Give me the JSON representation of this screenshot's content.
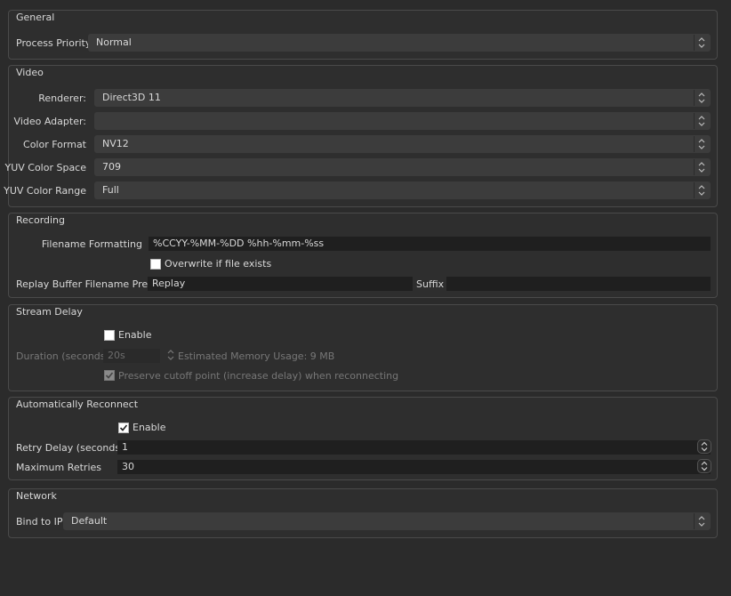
{
  "general": {
    "title": "General",
    "process_priority_label": "Process Priority",
    "process_priority_value": "Normal"
  },
  "video": {
    "title": "Video",
    "renderer_label": "Renderer:",
    "renderer_value": "Direct3D 11",
    "adapter_label": "Video Adapter:",
    "adapter_value": "",
    "color_format_label": "Color Format",
    "color_format_value": "NV12",
    "yuv_space_label": "YUV Color Space",
    "yuv_space_value": "709",
    "yuv_range_label": "YUV Color Range",
    "yuv_range_value": "Full"
  },
  "recording": {
    "title": "Recording",
    "filename_label": "Filename Formatting",
    "filename_value": "%CCYY-%MM-%DD %hh-%mm-%ss",
    "overwrite_label": "Overwrite if file exists",
    "overwrite_checked": false,
    "replay_prefix_label": "Replay Buffer Filename Prefix",
    "replay_prefix_value": "Replay",
    "suffix_label": "Suffix",
    "suffix_value": ""
  },
  "stream_delay": {
    "title": "Stream Delay",
    "enable_label": "Enable",
    "enable_checked": false,
    "duration_label": "Duration (seconds)",
    "duration_value": "20s",
    "memory_text": "Estimated Memory Usage: 9 MB",
    "preserve_label": "Preserve cutoff point (increase delay) when reconnecting",
    "preserve_checked": true
  },
  "reconnect": {
    "title": "Automatically Reconnect",
    "enable_label": "Enable",
    "enable_checked": true,
    "retry_delay_label": "Retry Delay (seconds)",
    "retry_delay_value": "1",
    "max_retries_label": "Maximum Retries",
    "max_retries_value": "30"
  },
  "network": {
    "title": "Network",
    "bind_label": "Bind to IP",
    "bind_value": "Default"
  }
}
